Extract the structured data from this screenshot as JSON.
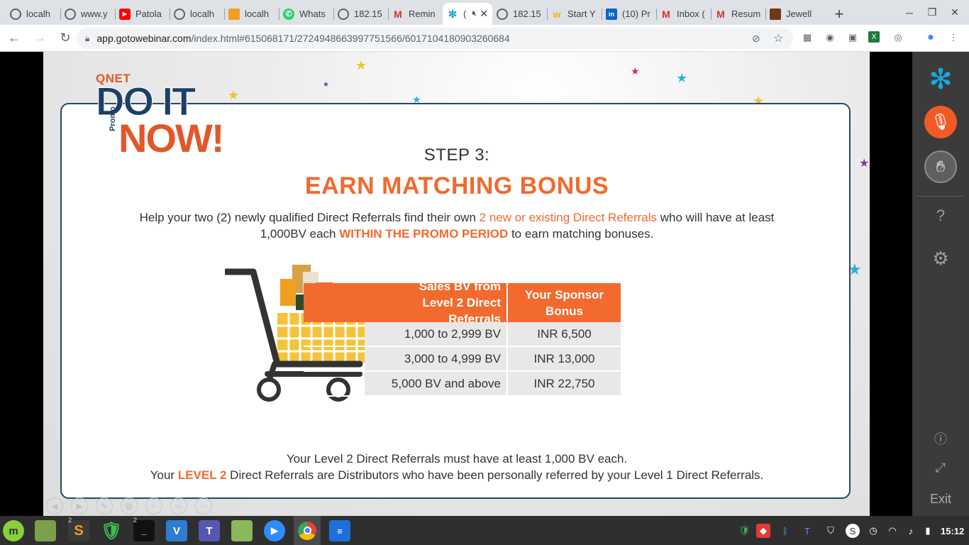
{
  "browser": {
    "tabs": [
      {
        "title": "localh",
        "icon": "globe-icon",
        "active": false
      },
      {
        "title": "www.y",
        "icon": "globe-icon",
        "active": false
      },
      {
        "title": "Patola",
        "icon": "youtube-icon",
        "active": false
      },
      {
        "title": "localh",
        "icon": "globe-icon",
        "active": false
      },
      {
        "title": "localh",
        "icon": "phpmyadmin-icon",
        "active": false
      },
      {
        "title": "Whats",
        "icon": "whatsapp-icon",
        "active": false
      },
      {
        "title": "182.15",
        "icon": "globe-icon",
        "active": false
      },
      {
        "title": "Remin",
        "icon": "gmail-icon",
        "active": false
      },
      {
        "title": "(",
        "icon": "gotowebinar-icon",
        "active": true
      },
      {
        "title": "182.15",
        "icon": "globe-icon",
        "active": false
      },
      {
        "title": "Start Y",
        "icon": "w-icon",
        "active": false
      },
      {
        "title": "(10) Pr",
        "icon": "linkedin-icon",
        "active": false
      },
      {
        "title": "Inbox (",
        "icon": "gmail-icon",
        "active": false
      },
      {
        "title": "Resum",
        "icon": "gmail-icon",
        "active": false
      },
      {
        "title": "Jewell",
        "icon": "jewel-icon",
        "active": false
      }
    ],
    "url_host": "app.gotowebinar.com",
    "url_path": "/index.html#615068171/2724948663997751566/6017104180903260684"
  },
  "slide": {
    "logo_brand": "QNET",
    "logo_line1": "DO IT",
    "logo_promo": "Promo",
    "logo_line2": "NOW!",
    "step": "STEP 3:",
    "heading": "EARN MATCHING BONUS",
    "desc_part1": "Help your two (2) newly qualified Direct Referrals find their own ",
    "desc_hl1": "2 new or existing Direct Referrals",
    "desc_part2": " who will have at least 1,000BV each ",
    "desc_hl2": "WITHIN THE PROMO PERIOD",
    "desc_part3": " to earn matching bonuses.",
    "table": {
      "headers": [
        "Sales BV from Level 2 Direct Referrals",
        "Your Sponsor Bonus"
      ],
      "rows": [
        [
          "1,000 to 2,999 BV",
          "INR 6,500"
        ],
        [
          "3,000 to 4,999 BV",
          "INR 13,000"
        ],
        [
          "5,000 BV and above",
          "INR 22,750"
        ]
      ]
    },
    "footer1": "Your Level 2 Direct Referrals must have at least 1,000 BV each.",
    "footer2_a": "Your ",
    "footer2_hl": "LEVEL 2",
    "footer2_b": " Direct Referrals are Distributors who have been personally referred by your Level 1 Direct Referrals."
  },
  "panel": {
    "exit_label": "Exit",
    "accent": "#19a8dc",
    "mic_color": "#f15a24"
  },
  "taskbar": {
    "clock": "15:12",
    "badge_sublime": "2",
    "badge_terminal": "2"
  }
}
